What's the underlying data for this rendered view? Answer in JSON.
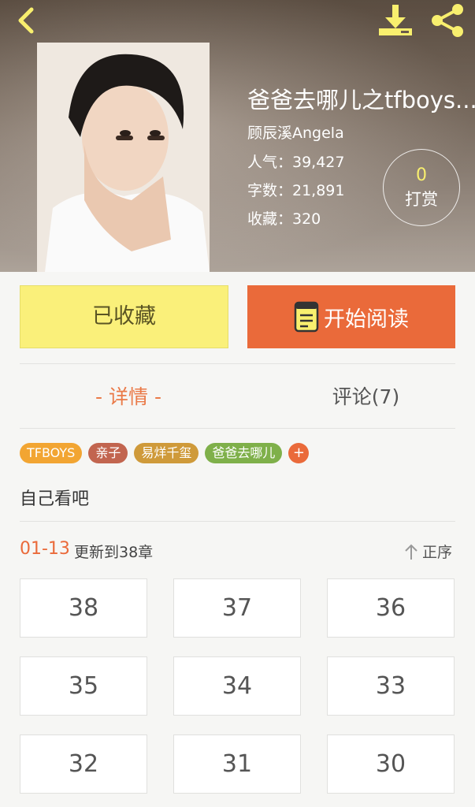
{
  "book": {
    "title": "爸爸去哪儿之tfboys...",
    "author": "顾辰溪Angela",
    "stats": [
      {
        "label": "人气：39,427"
      },
      {
        "label": "字数：21,891"
      },
      {
        "label": "收藏：320"
      }
    ],
    "reward_count": "0",
    "reward_label": "打赏"
  },
  "actions": {
    "favorite_label": "已收藏",
    "read_label": "开始阅读"
  },
  "tabs": {
    "detail": "- 详情 -",
    "comments": "评论(7)"
  },
  "tags": [
    {
      "label": "TFBOYS",
      "color": "#f2a532"
    },
    {
      "label": "亲子",
      "color": "#c2654f"
    },
    {
      "label": "易烊千玺",
      "color": "#cf9a3a"
    },
    {
      "label": "爸爸去哪儿",
      "color": "#7fb04a"
    }
  ],
  "tag_more": "+",
  "description": "自己看吧",
  "update": {
    "date": "01-13",
    "text": "更新到38章",
    "sort_label": "正序"
  },
  "chapters": [
    "38",
    "37",
    "36",
    "35",
    "34",
    "33",
    "32",
    "31",
    "30"
  ],
  "colors": {
    "accent": "#ea6a3a",
    "favorite": "#faf07a",
    "icon_yellow": "#f8ef6e"
  },
  "icons": [
    "back-icon",
    "download-icon",
    "share-icon",
    "book-icon",
    "arrow-up-icon"
  ]
}
